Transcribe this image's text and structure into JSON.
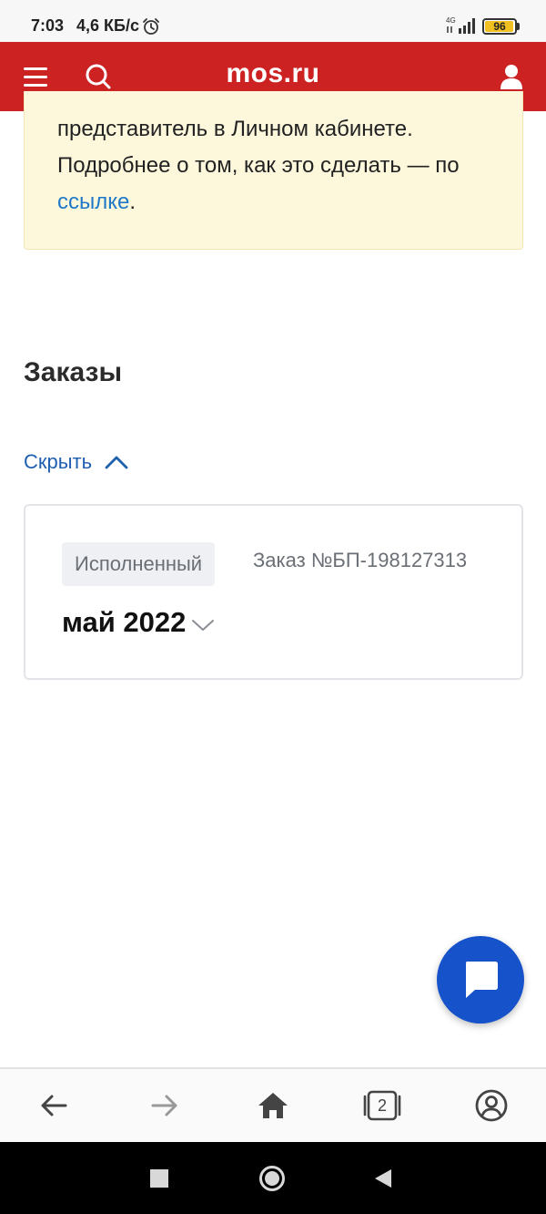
{
  "status_bar": {
    "time": "7:03",
    "speed": "4,6 КБ/с",
    "network": "4G",
    "battery": "96",
    "battery_level": 0.96,
    "battery_color": "#f0c020"
  },
  "header": {
    "title": "mos.ru",
    "background": "#cc2222"
  },
  "notice": {
    "line1": "представитель в Личном кабинете.",
    "line2": "Подробнее о том, как это сделать — по",
    "link": "ссылке",
    "suffix": "."
  },
  "orders": {
    "title": "Заказы",
    "toggle_label": "Скрыть",
    "items": [
      {
        "status": "Исполненный",
        "number": "Заказ №БП-198127313",
        "date": "май 2022"
      }
    ]
  },
  "colors": {
    "accent_red": "#cc2222",
    "link_blue": "#1f5fb0",
    "fab_blue": "#1652c9",
    "notice_bg": "#fdf7dc"
  },
  "bottom_nav": {
    "tabs_count": "2"
  }
}
